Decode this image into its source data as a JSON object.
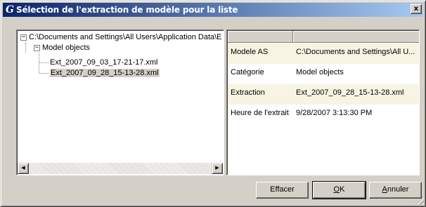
{
  "window": {
    "title": "Sélection de l'extraction de modèle pour la liste",
    "icon": "G",
    "close_symbol": "x"
  },
  "tree": {
    "root": {
      "label": "C:\\Documents and Settings\\All Users\\Application Data\\E",
      "expander": "−"
    },
    "group": {
      "label": "Model objects",
      "expander": "−"
    },
    "items": [
      {
        "label": "Ext_2007_09_03_17-21-17.xml",
        "selected": false
      },
      {
        "label": "Ext_2007_09_28_15-13-28.xml",
        "selected": true
      }
    ]
  },
  "scrollbar": {
    "left_arrow": "◀",
    "right_arrow": "▶"
  },
  "properties": {
    "rows": [
      {
        "name": "Modele AS",
        "value": "C:\\Documents and Settings\\All U..."
      },
      {
        "name": "Catégorie",
        "value": "Model objects"
      },
      {
        "name": "Extraction",
        "value": "Ext_2007_09_28_15-13-28.xml"
      },
      {
        "name": "Heure de l'extrait",
        "value": "9/28/2007 3:13:30 PM"
      }
    ]
  },
  "buttons": {
    "clear": "Effacer",
    "ok_mnemonic": "O",
    "ok_rest": "K",
    "cancel_mnemonic": "A",
    "cancel_rest": "nnuler"
  },
  "colors": {
    "titlebar_start": "#0a246a",
    "titlebar_end": "#a6caf0",
    "face": "#d4d0c8",
    "grid_alt_row": "#f7f4e3"
  }
}
